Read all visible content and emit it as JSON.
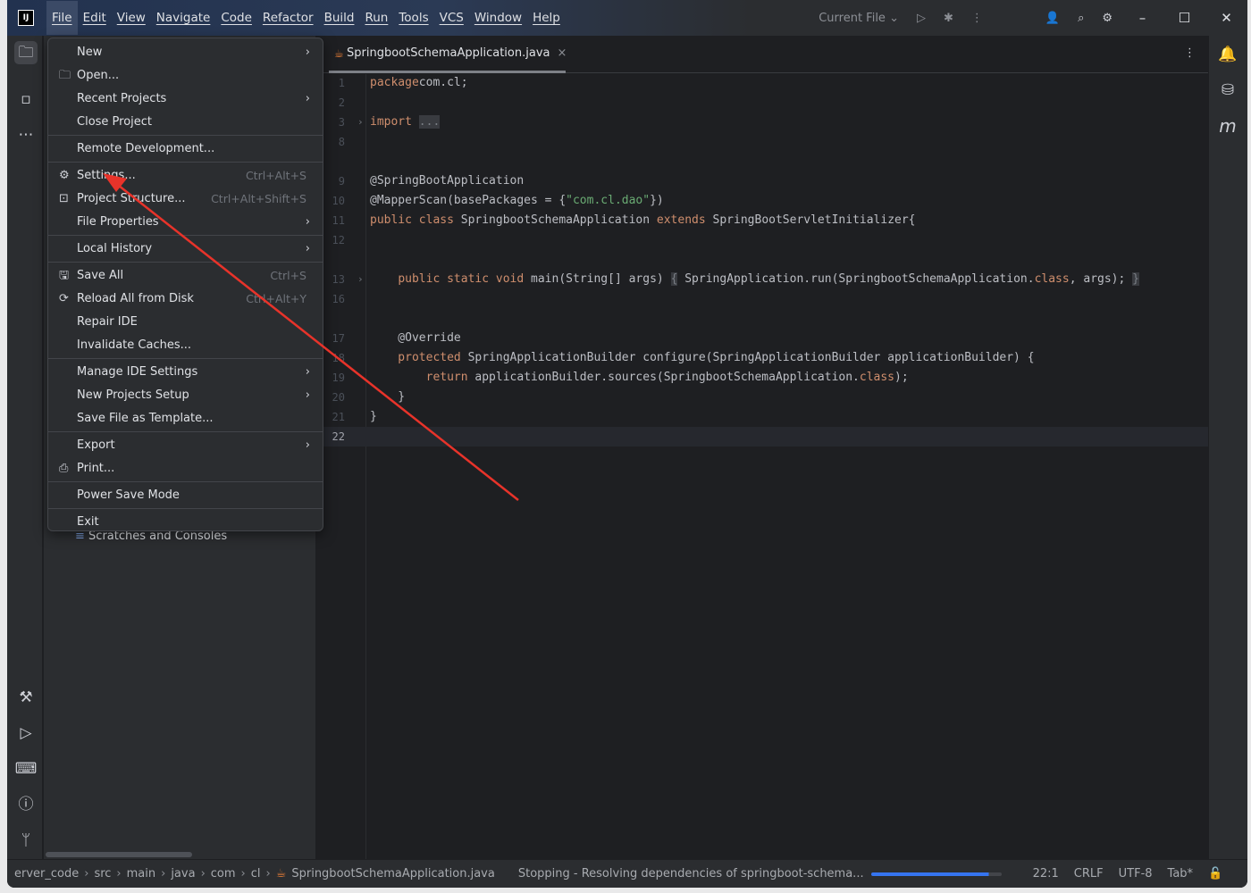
{
  "titlebar": {
    "menus": [
      "File",
      "Edit",
      "View",
      "Navigate",
      "Code",
      "Refactor",
      "Build",
      "Run",
      "Tools",
      "VCS",
      "Window",
      "Help"
    ],
    "run_config": "Current File"
  },
  "file_menu": [
    {
      "label": "New",
      "submenu": true
    },
    {
      "label": "Open...",
      "icon": "folder-icon"
    },
    {
      "label": "Recent Projects",
      "submenu": true
    },
    {
      "label": "Close Project"
    },
    {
      "sep": true
    },
    {
      "label": "Remote Development..."
    },
    {
      "sep": true
    },
    {
      "label": "Settings...",
      "icon": "gear-icon",
      "shortcut": "Ctrl+Alt+S"
    },
    {
      "label": "Project Structure...",
      "icon": "project-structure-icon",
      "shortcut": "Ctrl+Alt+Shift+S"
    },
    {
      "label": "File Properties",
      "submenu": true
    },
    {
      "sep": true
    },
    {
      "label": "Local History",
      "submenu": true
    },
    {
      "sep": true
    },
    {
      "label": "Save All",
      "icon": "save-icon",
      "shortcut": "Ctrl+S"
    },
    {
      "label": "Reload All from Disk",
      "icon": "reload-icon",
      "shortcut": "Ctrl+Alt+Y"
    },
    {
      "label": "Repair IDE"
    },
    {
      "label": "Invalidate Caches..."
    },
    {
      "sep": true
    },
    {
      "label": "Manage IDE Settings",
      "submenu": true
    },
    {
      "label": "New Projects Setup",
      "submenu": true
    },
    {
      "label": "Save File as Template..."
    },
    {
      "sep": true
    },
    {
      "label": "Export",
      "submenu": true
    },
    {
      "label": "Print...",
      "icon": "print-icon"
    },
    {
      "sep": true
    },
    {
      "label": "Power Save Mode"
    },
    {
      "sep": true
    },
    {
      "label": "Exit"
    }
  ],
  "project_panel": {
    "scratches": "Scratches and Consoles"
  },
  "editor": {
    "tab": "SpringbootSchemaApplication.java",
    "lines": [
      {
        "n": "1",
        "t": [
          [
            "kw",
            "package"
          ],
          [
            "",
            "com.cl;"
          ]
        ]
      },
      {
        "n": "2",
        "t": []
      },
      {
        "n": "3",
        "fold": true,
        "t": [
          [
            "kw",
            "import"
          ],
          [
            "",
            " "
          ],
          [
            "fld",
            "..."
          ]
        ]
      },
      {
        "n": "8",
        "t": []
      },
      {
        "n": "",
        "t": []
      },
      {
        "n": "9",
        "t": [
          [
            "",
            "@SpringBootApplication"
          ]
        ]
      },
      {
        "n": "10",
        "t": [
          [
            "",
            "@MapperScan(basePackages = {"
          ],
          [
            "str",
            "\"com.cl.dao\""
          ],
          [
            "",
            "})"
          ]
        ]
      },
      {
        "n": "11",
        "t": [
          [
            "kw",
            "public class "
          ],
          [
            "",
            "SpringbootSchemaApplication "
          ],
          [
            "kw",
            "extends "
          ],
          [
            "",
            "SpringBootServletInitializer{"
          ]
        ]
      },
      {
        "n": "12",
        "t": []
      },
      {
        "n": "",
        "t": []
      },
      {
        "n": "13",
        "fold": true,
        "t": [
          [
            "",
            "    "
          ],
          [
            "kw",
            "public static void "
          ],
          [
            "",
            "main(String[] args) "
          ],
          [
            "fld",
            "{"
          ],
          [
            "",
            " SpringApplication.run(SpringbootSchemaApplication."
          ],
          [
            "kw",
            "class"
          ],
          [
            "",
            ", args); "
          ],
          [
            "fld",
            "}"
          ]
        ]
      },
      {
        "n": "16",
        "t": []
      },
      {
        "n": "",
        "t": []
      },
      {
        "n": "17",
        "t": [
          [
            "",
            "    @Override"
          ]
        ]
      },
      {
        "n": "18",
        "t": [
          [
            "kw",
            "    protected "
          ],
          [
            "",
            "SpringApplicationBuilder configure(SpringApplicationBuilder applicationBuilder) {"
          ]
        ]
      },
      {
        "n": "19",
        "t": [
          [
            "kw",
            "        return "
          ],
          [
            "",
            "applicationBuilder.sources(SpringbootSchemaApplication."
          ],
          [
            "kw",
            "class"
          ],
          [
            "",
            ");"
          ]
        ]
      },
      {
        "n": "20",
        "t": [
          [
            "",
            "    }"
          ]
        ]
      },
      {
        "n": "21",
        "t": [
          [
            "",
            "}"
          ]
        ]
      },
      {
        "n": "22",
        "cur": true,
        "t": []
      }
    ]
  },
  "statusbar": {
    "breadcrumbs": [
      "erver_code",
      "src",
      "main",
      "java",
      "com",
      "cl",
      "SpringbootSchemaApplication.java"
    ],
    "task": "Stopping - Resolving dependencies of springboot-schema...",
    "progress": 0.9,
    "position": "22:1",
    "line_sep": "CRLF",
    "encoding": "UTF-8",
    "indent": "Tab*"
  },
  "colors": {
    "accent": "#3574f0",
    "keyword": "#cf8e6d",
    "string": "#6aab73",
    "annotation_arrow": "#e8332a"
  }
}
